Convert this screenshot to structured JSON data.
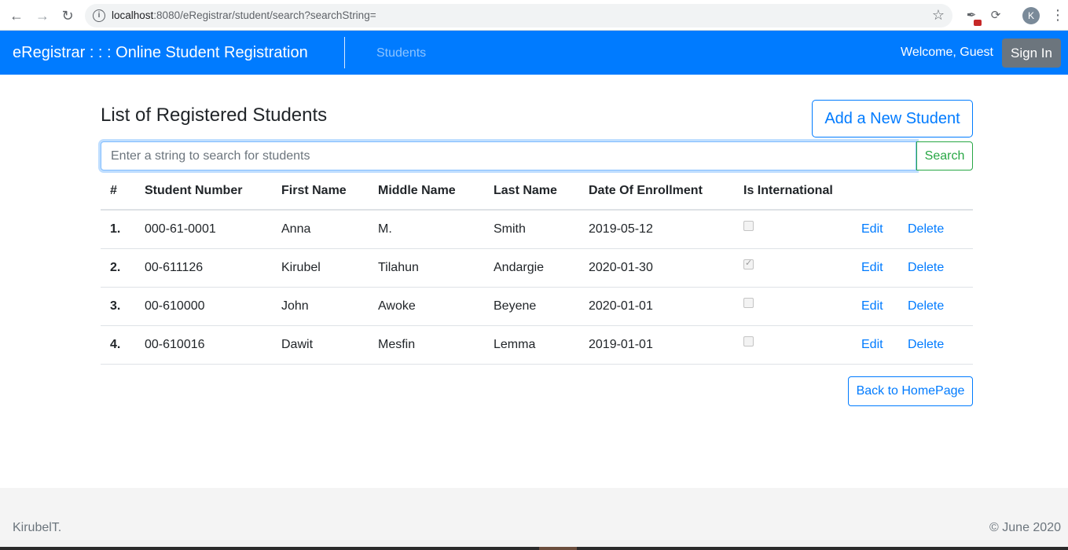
{
  "browser": {
    "url_host": "localhost",
    "url_path": ":8080/eRegistrar/student/search?searchString=",
    "profile_initial": "K"
  },
  "navbar": {
    "brand": "eRegistrar : : : Online Student Registration",
    "students_link": "Students",
    "welcome": "Welcome, Guest",
    "signin": "Sign In"
  },
  "main": {
    "title": "List of Registered Students",
    "add_button": "Add a New Student",
    "search_placeholder": "Enter a string to search for students",
    "search_value": "",
    "search_button": "Search",
    "back_button": "Back to HomePage"
  },
  "table": {
    "headers": [
      "#",
      "Student Number",
      "First Name",
      "Middle Name",
      "Last Name",
      "Date Of Enrollment",
      "Is International"
    ],
    "rows": [
      {
        "num": "1.",
        "student_number": "000-61-0001",
        "first": "Anna",
        "middle": "M.",
        "last": "Smith",
        "date": "2019-05-12",
        "international": false
      },
      {
        "num": "2.",
        "student_number": "00-611126",
        "first": "Kirubel",
        "middle": "Tilahun",
        "last": "Andargie",
        "date": "2020-01-30",
        "international": true
      },
      {
        "num": "3.",
        "student_number": "00-610000",
        "first": "John",
        "middle": "Awoke",
        "last": "Beyene",
        "date": "2020-01-01",
        "international": false
      },
      {
        "num": "4.",
        "student_number": "00-610016",
        "first": "Dawit",
        "middle": "Mesfin",
        "last": "Lemma",
        "date": "2019-01-01",
        "international": false
      }
    ],
    "edit_label": "Edit",
    "delete_label": "Delete"
  },
  "footer": {
    "left": "KirubelT.",
    "right": "© June 2020"
  },
  "colors": {
    "primary": "#007bff",
    "success": "#28a745",
    "secondary": "#6c757d"
  }
}
